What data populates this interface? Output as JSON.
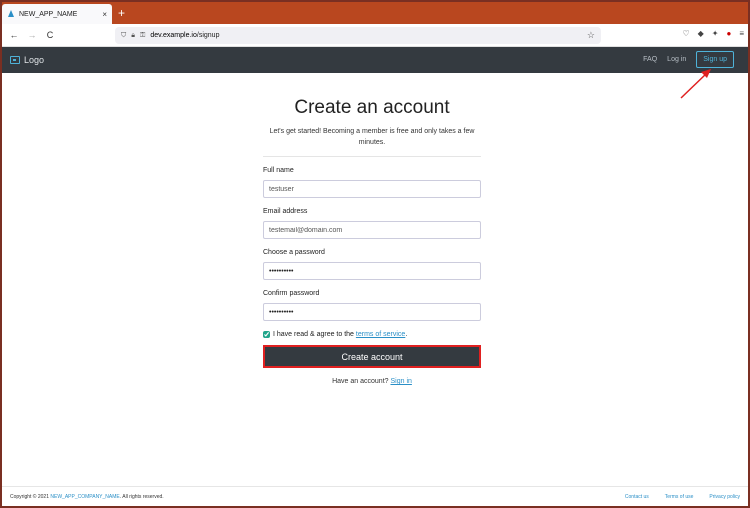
{
  "browser": {
    "tab_title": "NEW_APP_NAME",
    "tab_close": "×",
    "new_tab": "+",
    "back": "←",
    "forward": "→",
    "reload": "C",
    "url_domain": "dev.example.io",
    "url_path": "/signup",
    "star": "☆"
  },
  "site": {
    "logo": "Logo",
    "nav": {
      "faq": "FAQ",
      "login": "Log in",
      "signup": "Sign up"
    }
  },
  "form": {
    "title": "Create an account",
    "subtitle": "Let's get started! Becoming a member is free and only takes a few minutes.",
    "fullname_label": "Full name",
    "fullname_value": "testuser",
    "email_label": "Email address",
    "email_value": "testemail@domain.com",
    "password_label": "Choose a password",
    "password_value": "••••••••••",
    "confirm_label": "Confirm password",
    "confirm_value": "••••••••••",
    "agree_text": "I have read & agree to the ",
    "agree_link": "terms of service",
    "agree_end": ".",
    "submit": "Create account",
    "have_account": "Have an account? ",
    "signin_link": "Sign in"
  },
  "footer": {
    "copyright": "Copyright © 2021 ",
    "company": "NEW_APP_COMPANY_NAME",
    "rights": ". All rights reserved.",
    "contact": "Contact us",
    "terms": "Terms of use",
    "privacy": "Privacy policy"
  },
  "colors": {
    "tabstrip": "#b9471f",
    "header": "#343a40",
    "accent": "#4fb3d9",
    "highlight": "#e02020"
  }
}
